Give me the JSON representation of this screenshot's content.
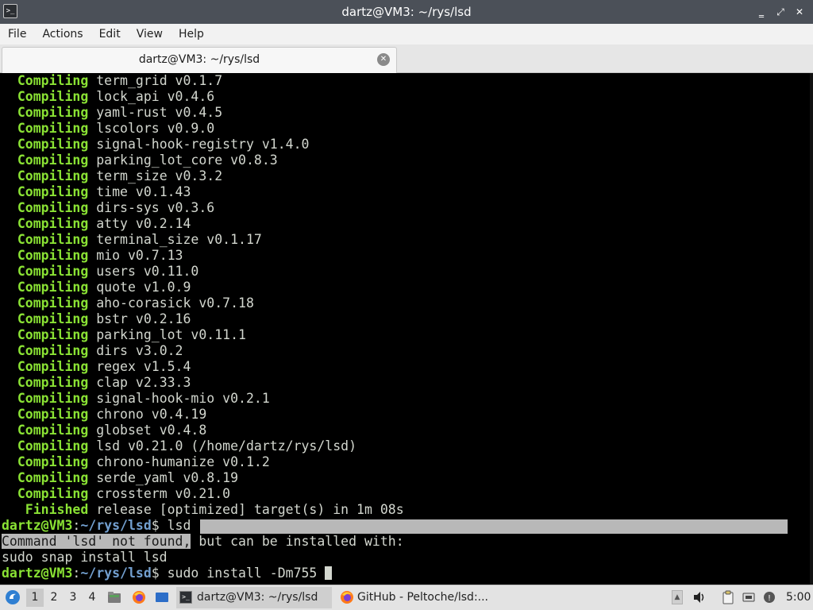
{
  "window": {
    "title": "dartz@VM3: ~/rys/lsd",
    "app_icon_glyph": ">_",
    "buttons": {
      "minimize": "‗",
      "maximize": "⤢",
      "close": "✕"
    }
  },
  "menubar": {
    "items": [
      "File",
      "Actions",
      "Edit",
      "View",
      "Help"
    ]
  },
  "tab": {
    "label": "dartz@VM3: ~/rys/lsd"
  },
  "terminal": {
    "compiling": [
      {
        "kw": "Compiling",
        "text": "term_grid v0.1.7"
      },
      {
        "kw": "Compiling",
        "text": "lock_api v0.4.6"
      },
      {
        "kw": "Compiling",
        "text": "yaml-rust v0.4.5"
      },
      {
        "kw": "Compiling",
        "text": "lscolors v0.9.0"
      },
      {
        "kw": "Compiling",
        "text": "signal-hook-registry v1.4.0"
      },
      {
        "kw": "Compiling",
        "text": "parking_lot_core v0.8.3"
      },
      {
        "kw": "Compiling",
        "text": "term_size v0.3.2"
      },
      {
        "kw": "Compiling",
        "text": "time v0.1.43"
      },
      {
        "kw": "Compiling",
        "text": "dirs-sys v0.3.6"
      },
      {
        "kw": "Compiling",
        "text": "atty v0.2.14"
      },
      {
        "kw": "Compiling",
        "text": "terminal_size v0.1.17"
      },
      {
        "kw": "Compiling",
        "text": "mio v0.7.13"
      },
      {
        "kw": "Compiling",
        "text": "users v0.11.0"
      },
      {
        "kw": "Compiling",
        "text": "quote v1.0.9"
      },
      {
        "kw": "Compiling",
        "text": "aho-corasick v0.7.18"
      },
      {
        "kw": "Compiling",
        "text": "bstr v0.2.16"
      },
      {
        "kw": "Compiling",
        "text": "parking_lot v0.11.1"
      },
      {
        "kw": "Compiling",
        "text": "dirs v3.0.2"
      },
      {
        "kw": "Compiling",
        "text": "regex v1.5.4"
      },
      {
        "kw": "Compiling",
        "text": "clap v2.33.3"
      },
      {
        "kw": "Compiling",
        "text": "signal-hook-mio v0.2.1"
      },
      {
        "kw": "Compiling",
        "text": "chrono v0.4.19"
      },
      {
        "kw": "Compiling",
        "text": "globset v0.4.8"
      },
      {
        "kw": "Compiling",
        "text": "lsd v0.21.0 (/home/dartz/rys/lsd)"
      },
      {
        "kw": "Compiling",
        "text": "chrono-humanize v0.1.2"
      },
      {
        "kw": "Compiling",
        "text": "serde_yaml v0.8.19"
      },
      {
        "kw": "Compiling",
        "text": "crossterm v0.21.0"
      },
      {
        "kw": " Finished",
        "text": "release [optimized] target(s) in 1m 08s"
      }
    ],
    "prompt_user": "dartz@VM3",
    "prompt_colon": ":",
    "prompt_path": "~/rys/lsd",
    "prompt_symbol": "$",
    "command1": " lsd",
    "error_highlighted": "Command 'lsd' not found,",
    "error_rest": " but can be installed with:",
    "suggestion": "sudo snap install lsd",
    "command2": " sudo install -Dm755 "
  },
  "taskbar": {
    "workspaces": [
      "1",
      "2",
      "3",
      "4"
    ],
    "tasks": [
      {
        "label": "dartz@VM3: ~/rys/lsd"
      },
      {
        "label": "GitHub - Peltoche/lsd:..."
      }
    ],
    "clock": "5:00"
  }
}
